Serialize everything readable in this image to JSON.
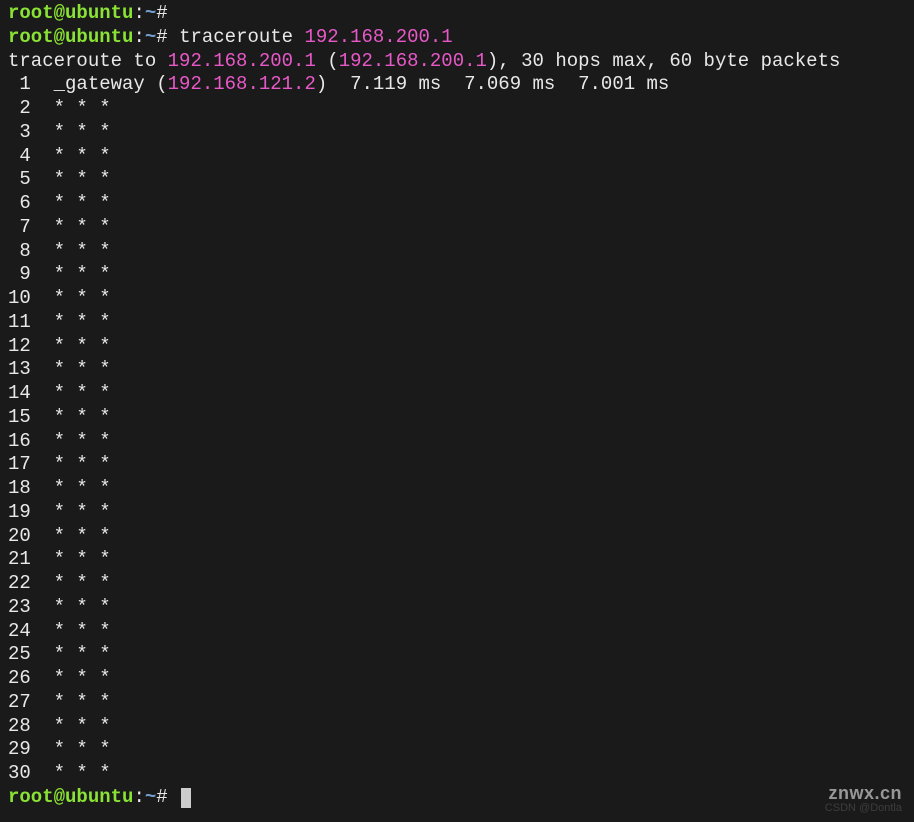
{
  "prompt": {
    "user": "root",
    "at": "@",
    "host": "ubuntu",
    "colon": ":",
    "path": "~",
    "hash": "# "
  },
  "command": {
    "cmd": "traceroute ",
    "arg": "192.168.200.1"
  },
  "header": {
    "prefix": "traceroute to ",
    "ip1": "192.168.200.1",
    "open": " (",
    "ip2": "192.168.200.1",
    "close": ")",
    "rest": ", 30 hops max, 60 byte packets"
  },
  "hop1": {
    "num": " 1",
    "gap": "  ",
    "name": "_gateway (",
    "ip": "192.168.121.2",
    "close": ")",
    "times": "  7.119 ms  7.069 ms  7.001 ms"
  },
  "starline": "  * * *",
  "hops": [
    " 2",
    " 3",
    " 4",
    " 5",
    " 6",
    " 7",
    " 8",
    " 9",
    "10",
    "11",
    "12",
    "13",
    "14",
    "15",
    "16",
    "17",
    "18",
    "19",
    "20",
    "21",
    "22",
    "23",
    "24",
    "25",
    "26",
    "27",
    "28",
    "29",
    "30"
  ],
  "watermark1": "znwx.cn",
  "watermark2": "CSDN @Dontla"
}
